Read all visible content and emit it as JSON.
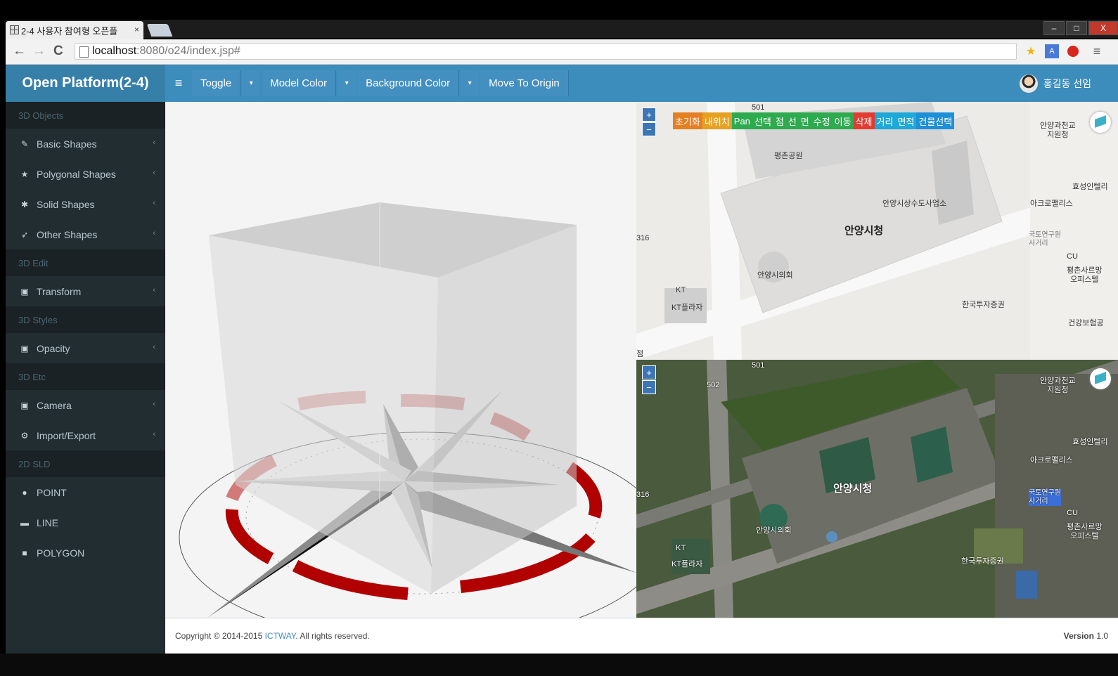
{
  "browser": {
    "tab_title": "2-4 사용자 참여형 오픈플",
    "tab_close": "×",
    "url_host": "localhost",
    "url_rest": ":8080/o24/index.jsp#",
    "back_glyph": "←",
    "forward_glyph": "→",
    "reload_glyph": "C",
    "menu_glyph": "≡",
    "star_glyph": "★",
    "win_minimize": "–",
    "win_maximize": "□",
    "win_close": "X"
  },
  "header": {
    "brand": "Open Platform(2-4)",
    "menu_glyph": "≡",
    "menus": [
      {
        "label": "Toggle",
        "caret": "▾"
      },
      {
        "label": "Model Color",
        "caret": "▾"
      },
      {
        "label": "Background Color",
        "caret": "▾"
      }
    ],
    "move_to_origin": "Move To Origin",
    "user_name": "홍길동 선임"
  },
  "sidebar": {
    "sections": [
      {
        "title": "3D Objects",
        "items": [
          {
            "label": "Basic Shapes",
            "icon": "edit-icon",
            "glyph": "✎"
          },
          {
            "label": "Polygonal Shapes",
            "icon": "star-icon",
            "glyph": "★"
          },
          {
            "label": "Solid Shapes",
            "icon": "asterisk-icon",
            "glyph": "✱"
          },
          {
            "label": "Other Shapes",
            "icon": "rocket-icon",
            "glyph": "➶"
          }
        ]
      },
      {
        "title": "3D Edit",
        "items": [
          {
            "label": "Transform",
            "icon": "image-icon",
            "glyph": "▣"
          }
        ]
      },
      {
        "title": "3D Styles",
        "items": [
          {
            "label": "Opacity",
            "icon": "image-icon",
            "glyph": "▣"
          }
        ]
      },
      {
        "title": "3D Etc",
        "items": [
          {
            "label": "Camera",
            "icon": "image-icon",
            "glyph": "▣"
          },
          {
            "label": "Import/Export",
            "icon": "gears-icon",
            "glyph": "⚙"
          }
        ]
      },
      {
        "title": "2D SLD",
        "items": [
          {
            "label": "POINT",
            "icon": "circle-icon",
            "glyph": "●"
          },
          {
            "label": "LINE",
            "icon": "minus-icon",
            "glyph": "▬"
          },
          {
            "label": "POLYGON",
            "icon": "square-icon",
            "glyph": "■"
          }
        ]
      }
    ],
    "caret": "‹"
  },
  "map_tools": [
    {
      "label": "초기화",
      "color": "#e67e22"
    },
    {
      "label": "내위치",
      "color": "#e6a022"
    },
    {
      "label": "Pan",
      "color": "#2eaa4f"
    },
    {
      "label": "선택",
      "color": "#2eaa4f"
    },
    {
      "label": "점",
      "color": "#2eaa4f"
    },
    {
      "label": "선",
      "color": "#2eaa4f"
    },
    {
      "label": "면",
      "color": "#2eaa4f"
    },
    {
      "label": "수정",
      "color": "#2eaa4f"
    },
    {
      "label": "이동",
      "color": "#2eaa4f"
    },
    {
      "label": "삭제",
      "color": "#e03c31"
    },
    {
      "label": "거리",
      "color": "#1ea9d9"
    },
    {
      "label": "면적",
      "color": "#1ea9d9"
    },
    {
      "label": "건물선택",
      "color": "#1e8fd9"
    }
  ],
  "map": {
    "zoom_in": "+",
    "zoom_out": "−",
    "labels": {
      "city_hall": "안양시청",
      "water": "안양시상수도사업소",
      "council": "안양시의회",
      "park": "평촌공원",
      "kt": "KT",
      "kt_plaza": "KT플라자",
      "securities": "한국투자증권",
      "science": "안양과천교\n지원청",
      "acro": "아크로팰리스",
      "hyosung": "효성인텔리",
      "officetel": "평촌사르망\n오피스텔",
      "cu": "CU",
      "health": "건강보험공",
      "research": "국토연구원\n사거리",
      "num501": "501",
      "num502": "502",
      "num316": "316",
      "jeom": "점"
    }
  },
  "footer": {
    "copyright_prefix": "Copyright © 2014-2015 ",
    "company": "ICTWAY",
    "copyright_suffix": ". All rights reserved.",
    "version_label": "Version",
    "version": "1.0"
  },
  "colors": {
    "header": "#3c8dbc",
    "brand_bg": "#367fa9",
    "sidebar": "#222d32",
    "compass_red": "#b00000"
  }
}
